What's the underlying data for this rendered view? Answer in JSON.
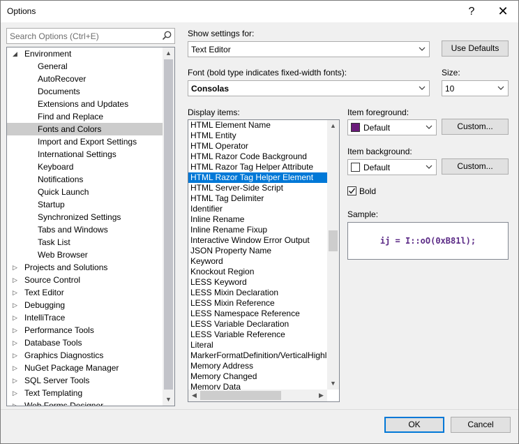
{
  "window": {
    "title": "Options",
    "help_glyph": "?",
    "close_glyph": "✕"
  },
  "search": {
    "placeholder": "Search Options (Ctrl+E)"
  },
  "tree": {
    "items": [
      {
        "label": "Environment",
        "level": 0,
        "expanded": true
      },
      {
        "label": "General",
        "level": 1
      },
      {
        "label": "AutoRecover",
        "level": 1
      },
      {
        "label": "Documents",
        "level": 1
      },
      {
        "label": "Extensions and Updates",
        "level": 1
      },
      {
        "label": "Find and Replace",
        "level": 1
      },
      {
        "label": "Fonts and Colors",
        "level": 1,
        "selected": true
      },
      {
        "label": "Import and Export Settings",
        "level": 1
      },
      {
        "label": "International Settings",
        "level": 1
      },
      {
        "label": "Keyboard",
        "level": 1
      },
      {
        "label": "Notifications",
        "level": 1
      },
      {
        "label": "Quick Launch",
        "level": 1
      },
      {
        "label": "Startup",
        "level": 1
      },
      {
        "label": "Synchronized Settings",
        "level": 1
      },
      {
        "label": "Tabs and Windows",
        "level": 1
      },
      {
        "label": "Task List",
        "level": 1
      },
      {
        "label": "Web Browser",
        "level": 1
      },
      {
        "label": "Projects and Solutions",
        "level": 0
      },
      {
        "label": "Source Control",
        "level": 0
      },
      {
        "label": "Text Editor",
        "level": 0
      },
      {
        "label": "Debugging",
        "level": 0
      },
      {
        "label": "IntelliTrace",
        "level": 0
      },
      {
        "label": "Performance Tools",
        "level": 0
      },
      {
        "label": "Database Tools",
        "level": 0
      },
      {
        "label": "Graphics Diagnostics",
        "level": 0
      },
      {
        "label": "NuGet Package Manager",
        "level": 0
      },
      {
        "label": "SQL Server Tools",
        "level": 0
      },
      {
        "label": "Text Templating",
        "level": 0
      },
      {
        "label": "Web Forms Designer",
        "level": 0
      }
    ]
  },
  "settings": {
    "show_label": "Show settings for:",
    "show_value": "Text Editor",
    "use_defaults": "Use Defaults",
    "font_label": "Font (bold type indicates fixed-width fonts):",
    "font_value": "Consolas",
    "size_label": "Size:",
    "size_value": "10",
    "display_label": "Display items:",
    "fg_label": "Item foreground:",
    "fg_value": "Default",
    "fg_color": "#6a1b7a",
    "bg_label": "Item background:",
    "bg_value": "Default",
    "bg_color": "#ffffff",
    "custom_label": "Custom...",
    "bold_label": "Bold",
    "bold_checked": true,
    "sample_label": "Sample:",
    "sample_text": "ij = I::oO(0xB81l);",
    "sample_color": "#5b2a86"
  },
  "display_items": [
    "HTML Element Name",
    "HTML Entity",
    "HTML Operator",
    "HTML Razor Code Background",
    "HTML Razor Tag Helper Attribute",
    "HTML Razor Tag Helper Element",
    "HTML Server-Side Script",
    "HTML Tag Delimiter",
    "Identifier",
    "Inline Rename",
    "Inline Rename Fixup",
    "Interactive Window Error Output",
    "JSON Property Name",
    "Keyword",
    "Knockout Region",
    "LESS Keyword",
    "LESS Mixin Declaration",
    "LESS Mixin Reference",
    "LESS Namespace Reference",
    "LESS Variable Declaration",
    "LESS Variable Reference",
    "Literal",
    "MarkerFormatDefinition/VerticalHighlight",
    "Memory Address",
    "Memory Changed",
    "Memory Data"
  ],
  "selected_display_item": "HTML Razor Tag Helper Element",
  "footer": {
    "ok": "OK",
    "cancel": "Cancel"
  }
}
